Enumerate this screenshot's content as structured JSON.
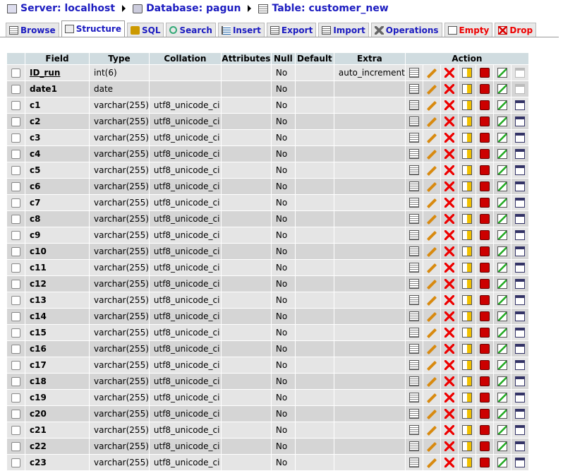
{
  "breadcrumb": {
    "server": "Server: localhost",
    "database": "Database: pagun",
    "table": "Table: customer_new"
  },
  "tabs": [
    {
      "label": "Browse",
      "icon": "browse-icon"
    },
    {
      "label": "Structure",
      "icon": "structure-icon",
      "active": true
    },
    {
      "label": "SQL",
      "icon": "sql-icon"
    },
    {
      "label": "Search",
      "icon": "search-icon"
    },
    {
      "label": "Insert",
      "icon": "insert-icon"
    },
    {
      "label": "Export",
      "icon": "export-icon"
    },
    {
      "label": "Import",
      "icon": "import-icon"
    },
    {
      "label": "Operations",
      "icon": "operations-icon"
    },
    {
      "label": "Empty",
      "icon": "empty-icon",
      "danger": true
    },
    {
      "label": "Drop",
      "icon": "drop-icon",
      "danger": true
    }
  ],
  "headers": {
    "field": "Field",
    "type": "Type",
    "collation": "Collation",
    "attributes": "Attributes",
    "null": "Null",
    "default": "Default",
    "extra": "Extra",
    "action": "Action"
  },
  "rows": [
    {
      "field": "ID_run",
      "type": "int(6)",
      "collation": "",
      "null": "No",
      "extra": "auto_increment",
      "pk": true
    },
    {
      "field": "date1",
      "type": "date",
      "collation": "",
      "null": "No",
      "extra": ""
    },
    {
      "field": "c1",
      "type": "varchar(255)",
      "collation": "utf8_unicode_ci",
      "null": "No",
      "extra": ""
    },
    {
      "field": "c2",
      "type": "varchar(255)",
      "collation": "utf8_unicode_ci",
      "null": "No",
      "extra": ""
    },
    {
      "field": "c3",
      "type": "varchar(255)",
      "collation": "utf8_unicode_ci",
      "null": "No",
      "extra": ""
    },
    {
      "field": "c4",
      "type": "varchar(255)",
      "collation": "utf8_unicode_ci",
      "null": "No",
      "extra": ""
    },
    {
      "field": "c5",
      "type": "varchar(255)",
      "collation": "utf8_unicode_ci",
      "null": "No",
      "extra": ""
    },
    {
      "field": "c6",
      "type": "varchar(255)",
      "collation": "utf8_unicode_ci",
      "null": "No",
      "extra": ""
    },
    {
      "field": "c7",
      "type": "varchar(255)",
      "collation": "utf8_unicode_ci",
      "null": "No",
      "extra": ""
    },
    {
      "field": "c8",
      "type": "varchar(255)",
      "collation": "utf8_unicode_ci",
      "null": "No",
      "extra": ""
    },
    {
      "field": "c9",
      "type": "varchar(255)",
      "collation": "utf8_unicode_ci",
      "null": "No",
      "extra": ""
    },
    {
      "field": "c10",
      "type": "varchar(255)",
      "collation": "utf8_unicode_ci",
      "null": "No",
      "extra": ""
    },
    {
      "field": "c11",
      "type": "varchar(255)",
      "collation": "utf8_unicode_ci",
      "null": "No",
      "extra": ""
    },
    {
      "field": "c12",
      "type": "varchar(255)",
      "collation": "utf8_unicode_ci",
      "null": "No",
      "extra": ""
    },
    {
      "field": "c13",
      "type": "varchar(255)",
      "collation": "utf8_unicode_ci",
      "null": "No",
      "extra": ""
    },
    {
      "field": "c14",
      "type": "varchar(255)",
      "collation": "utf8_unicode_ci",
      "null": "No",
      "extra": ""
    },
    {
      "field": "c15",
      "type": "varchar(255)",
      "collation": "utf8_unicode_ci",
      "null": "No",
      "extra": ""
    },
    {
      "field": "c16",
      "type": "varchar(255)",
      "collation": "utf8_unicode_ci",
      "null": "No",
      "extra": ""
    },
    {
      "field": "c17",
      "type": "varchar(255)",
      "collation": "utf8_unicode_ci",
      "null": "No",
      "extra": ""
    },
    {
      "field": "c18",
      "type": "varchar(255)",
      "collation": "utf8_unicode_ci",
      "null": "No",
      "extra": ""
    },
    {
      "field": "c19",
      "type": "varchar(255)",
      "collation": "utf8_unicode_ci",
      "null": "No",
      "extra": ""
    },
    {
      "field": "c20",
      "type": "varchar(255)",
      "collation": "utf8_unicode_ci",
      "null": "No",
      "extra": ""
    },
    {
      "field": "c21",
      "type": "varchar(255)",
      "collation": "utf8_unicode_ci",
      "null": "No",
      "extra": ""
    },
    {
      "field": "c22",
      "type": "varchar(255)",
      "collation": "utf8_unicode_ci",
      "null": "No",
      "extra": ""
    },
    {
      "field": "c23",
      "type": "varchar(255)",
      "collation": "utf8_unicode_ci",
      "null": "No",
      "extra": ""
    }
  ],
  "action_icons": [
    "browse-distinct-icon",
    "edit-icon",
    "delete-icon",
    "primary-key-icon",
    "unique-icon",
    "index-icon",
    "fulltext-icon"
  ]
}
